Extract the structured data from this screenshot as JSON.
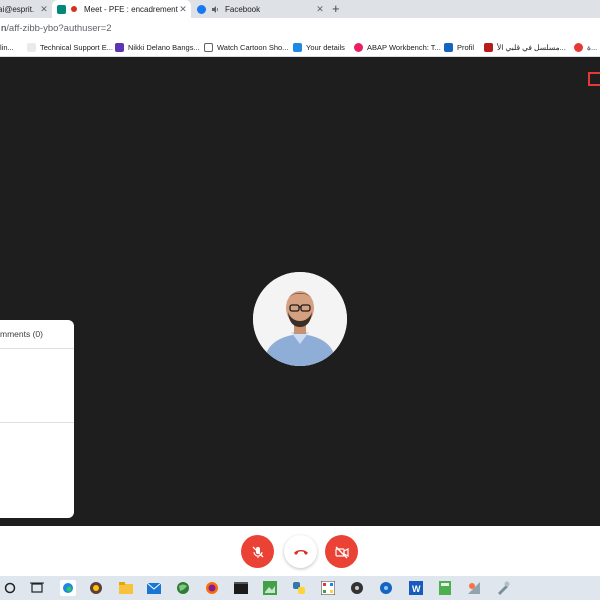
{
  "browser": {
    "tabs": [
      {
        "title": "ai@esprit.",
        "active": false,
        "favicon_color": "#1a73e8"
      },
      {
        "title": "Meet - PFE : encadrement",
        "active": true,
        "favicon_color": "#00897b",
        "recording_dot_color": "#d93025"
      },
      {
        "title": "Facebook",
        "active": false,
        "favicon_color": "#1877f2"
      }
    ],
    "new_tab_label": "+",
    "address": {
      "host": "n",
      "path": "/aff-zibb-ybo?authuser=2"
    },
    "bookmarks": [
      {
        "label": "lin..."
      },
      {
        "label": "Technical Support E..."
      },
      {
        "label": "Nikki Delano Bangs..."
      },
      {
        "label": "Watch Cartoon Sho..."
      },
      {
        "label": "Your details"
      },
      {
        "label": "ABAP Workbench: T..."
      },
      {
        "label": "Profil"
      },
      {
        "label": "مسلسل في قلبي الأ..."
      },
      {
        "label": "ة..."
      }
    ]
  },
  "meet": {
    "comments_title": "mments (0)",
    "controls": {
      "mic": {
        "icon": "mic-off-icon",
        "state": "muted",
        "color": "#ea4335"
      },
      "hangup": {
        "icon": "hang-up-icon",
        "color": "#d93025"
      },
      "camera": {
        "icon": "camera-off-icon",
        "state": "off",
        "color": "#ea4335"
      }
    }
  },
  "taskbar": {
    "icons": [
      "search-ring-icon",
      "task-view-icon",
      "edge-icon",
      "game-icon",
      "file-explorer-icon",
      "mail-icon",
      "globe-icon",
      "firefox-icon",
      "terminal-icon",
      "image-editor-icon",
      "python-icon",
      "video-editor-icon",
      "media-player-icon",
      "word-icon",
      "calculator-icon",
      "paint-icon",
      "tool-icon"
    ]
  }
}
